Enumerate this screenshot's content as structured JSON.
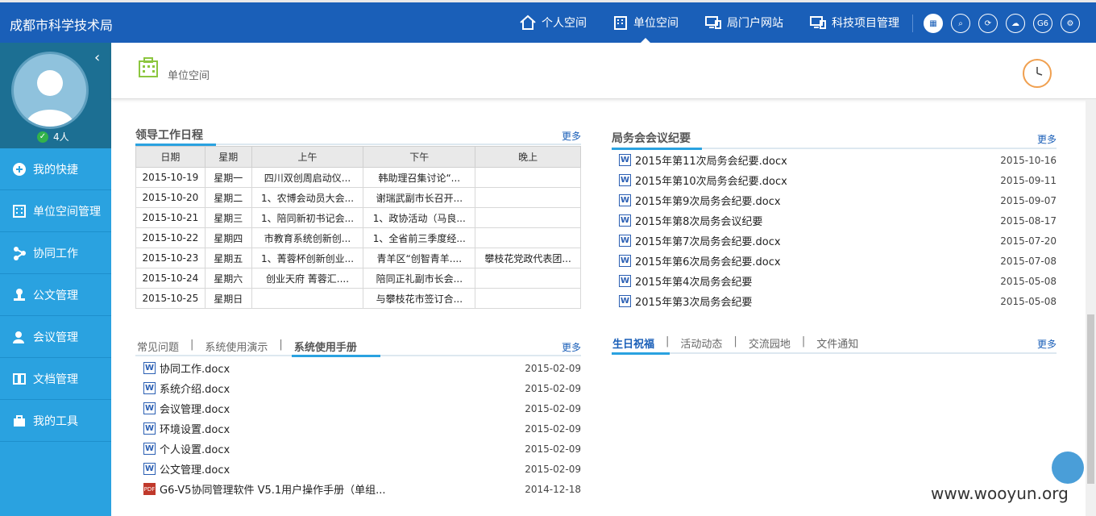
{
  "app": {
    "title": "成都市科学技术局"
  },
  "nav": [
    {
      "label": "个人空间",
      "icon": "home-icon"
    },
    {
      "label": "单位空间",
      "icon": "building-icon",
      "active": true
    },
    {
      "label": "局门户网站",
      "icon": "portal-icon"
    },
    {
      "label": "科技项目管理",
      "icon": "project-icon"
    }
  ],
  "tool_icons": [
    {
      "name": "grid-icon",
      "text": "▦"
    },
    {
      "name": "search-icon",
      "text": "⌕"
    },
    {
      "name": "refresh-icon",
      "text": "⟳"
    },
    {
      "name": "cloud-icon",
      "text": "☁"
    },
    {
      "name": "g6-icon",
      "text": "G6"
    },
    {
      "name": "gear-icon",
      "text": "⚙"
    }
  ],
  "sidebar": {
    "online_count": "4人",
    "items": [
      {
        "label": "我的快捷"
      },
      {
        "label": "单位空间管理"
      },
      {
        "label": "协同工作"
      },
      {
        "label": "公文管理"
      },
      {
        "label": "会议管理"
      },
      {
        "label": "文档管理"
      },
      {
        "label": "我的工具"
      }
    ]
  },
  "header": {
    "subtitle": "单位空间"
  },
  "schedule": {
    "title": "领导工作日程",
    "more": "更多",
    "columns": [
      "日期",
      "星期",
      "上午",
      "下午",
      "晚上"
    ],
    "rows": [
      [
        "2015-10-19",
        "星期一",
        "四川双创周启动仪...",
        "韩助理召集讨论“...",
        ""
      ],
      [
        "2015-10-20",
        "星期二",
        "1、农博会动员大会...",
        "谢瑞武副市长召开...",
        ""
      ],
      [
        "2015-10-21",
        "星期三",
        "1、陪同新初书记会...",
        "1、政协活动（马良...",
        ""
      ],
      [
        "2015-10-22",
        "星期四",
        "市教育系统创新创...",
        "1、全省前三季度经...",
        ""
      ],
      [
        "2015-10-23",
        "星期五",
        "1、菁蓉杯创新创业...",
        "青羊区“创智青羊....",
        "攀枝花党政代表团..."
      ],
      [
        "2015-10-24",
        "星期六",
        "创业天府 菁蓉汇....",
        "陪同正礼副市长会...",
        ""
      ],
      [
        "2015-10-25",
        "星期日",
        "",
        "与攀枝花市签订合...",
        ""
      ]
    ]
  },
  "meetings": {
    "title": "局务会会议纪要",
    "more": "更多",
    "items": [
      {
        "name": "2015年第11次局务会纪要.docx",
        "date": "2015-10-16"
      },
      {
        "name": "2015年第10次局务会纪要.docx",
        "date": "2015-09-11"
      },
      {
        "name": "2015年第9次局务会纪要.docx",
        "date": "2015-09-07"
      },
      {
        "name": "2015年第8次局务会议纪要",
        "date": "2015-08-17"
      },
      {
        "name": "2015年第7次局务会纪要.docx",
        "date": "2015-07-20"
      },
      {
        "name": "2015年第6次局务会纪要.docx",
        "date": "2015-07-08"
      },
      {
        "name": "2015年第4次局务会纪要",
        "date": "2015-05-08"
      },
      {
        "name": "2015年第3次局务会纪要",
        "date": "2015-05-08"
      }
    ]
  },
  "help": {
    "tabs": [
      "常见问题",
      "系统使用演示",
      "系统使用手册"
    ],
    "active_tab": 2,
    "more": "更多",
    "items": [
      {
        "name": "协同工作.docx",
        "date": "2015-02-09",
        "type": "W"
      },
      {
        "name": "系统介绍.docx",
        "date": "2015-02-09",
        "type": "W"
      },
      {
        "name": "会议管理.docx",
        "date": "2015-02-09",
        "type": "W"
      },
      {
        "name": "环境设置.docx",
        "date": "2015-02-09",
        "type": "W"
      },
      {
        "name": "个人设置.docx",
        "date": "2015-02-09",
        "type": "W"
      },
      {
        "name": "公文管理.docx",
        "date": "2015-02-09",
        "type": "W"
      },
      {
        "name": "G6-V5协同管理软件 V5.1用户操作手册（单组...",
        "date": "2014-12-18",
        "type": "PDF"
      }
    ]
  },
  "news": {
    "tabs": [
      "生日祝福",
      "活动动态",
      "交流园地",
      "文件通知"
    ],
    "active_tab": 0,
    "more": "更多"
  },
  "watermark": "www.wooyun.org",
  "colors": {
    "topbar": "#1a5fb8",
    "sidebar": "#2aa2e0",
    "profile": "#1c6f93",
    "accent": "#2aa2e0"
  }
}
